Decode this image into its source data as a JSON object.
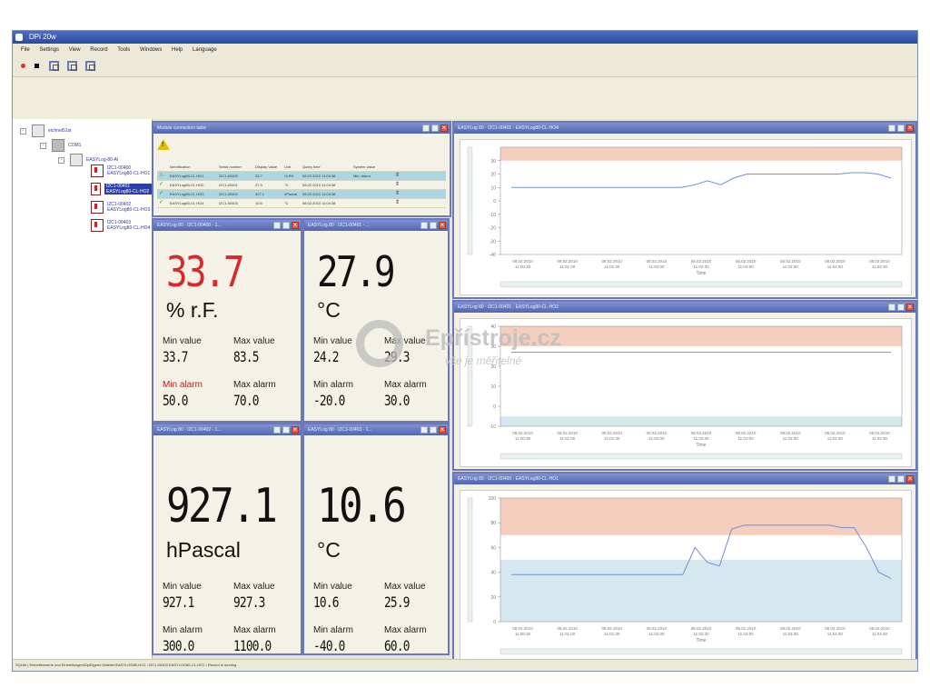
{
  "app": {
    "title": "DPi 20w"
  },
  "menu": [
    "File",
    "Settings",
    "View",
    "Record",
    "Tools",
    "Windows",
    "Help",
    "Language"
  ],
  "toolbar": {
    "icons": [
      "record-icon",
      "stop-icon",
      "window-icon",
      "window-icon",
      "window-icon"
    ]
  },
  "tree": {
    "items": [
      {
        "label": "eichnet51st",
        "depth": 0
      },
      {
        "label": "COM1",
        "depth": 1
      },
      {
        "label": "EASYLog-80-Al",
        "depth": 2
      },
      {
        "label": "I2C1-00400 EASYLog80-CL-HO1",
        "depth": 3
      },
      {
        "label": "I2C1-00401 EASYLog80-CL-HO2",
        "depth": 3,
        "selected": true
      },
      {
        "label": "I2C1-00402 EASYLog80-CL-HO3",
        "depth": 3
      },
      {
        "label": "I2C1-00403 EASYLog80-CL-HO4",
        "depth": 3
      }
    ]
  },
  "table_window": {
    "title": "Module connection table",
    "headers": [
      "",
      "Identification",
      "Serial number",
      "Display Value",
      "Unit",
      "Query time",
      "System value",
      ""
    ],
    "rows": [
      {
        "cells": [
          "",
          "EASYLog80-CL HO1",
          "I2C1-00400",
          "33.7",
          "% RH",
          "08.02.2010 11:04:38",
          "Min. Alarm",
          ""
        ],
        "status": "warn",
        "highlight": true
      },
      {
        "cells": [
          "",
          "EASYLog80-CL HO2",
          "I2C1-00401",
          "27.9",
          "°C",
          "08.02.2010 11:04:38",
          "",
          ""
        ],
        "status": "ok",
        "highlight": false
      },
      {
        "cells": [
          "",
          "EASYLog80-CL HO3",
          "I2C1-00402",
          "927.1",
          "hPascal",
          "08.02.2010 11:04:38",
          "",
          ""
        ],
        "status": "ok",
        "highlight": true
      },
      {
        "cells": [
          "",
          "EASYLog80-CL HO4",
          "I2C1-00403",
          "10.6",
          "°C",
          "08.02.2010 11:04:38",
          "",
          ""
        ],
        "status": "ok",
        "highlight": false
      }
    ]
  },
  "displays": [
    {
      "title": "EASYLog 80 · I2C1-00400 - 1...",
      "value": "33.7",
      "value_color": "#d8282a",
      "unit": "% r.F.",
      "min_value_label": "Min value",
      "min_value": "33.7",
      "max_value_label": "Max value",
      "max_value": "83.5",
      "min_alarm_label": "Min alarm",
      "min_alarm": "50.0",
      "min_alarm_red": true,
      "max_alarm_label": "Max alarm",
      "max_alarm": "70.0"
    },
    {
      "title": "EASYLog 80 · I2C1-00401 - ...",
      "value": "27.9",
      "value_color": "#111111",
      "unit": "°C",
      "min_value_label": "Min value",
      "min_value": "24.2",
      "max_value_label": "Max value",
      "max_value": "29.3",
      "min_alarm_label": "Min alarm",
      "min_alarm": "-20.0",
      "min_alarm_red": false,
      "max_alarm_label": "Max alarm",
      "max_alarm": "30.0"
    },
    {
      "title": "EASYLog 80 · I2C1-00402 - 1...",
      "value": "927.1",
      "value_color": "#111111",
      "unit": "hPascal",
      "min_value_label": "Min value",
      "min_value": "927.1",
      "max_value_label": "Max value",
      "max_value": "927.3",
      "min_alarm_label": "Min alarm",
      "min_alarm": "300.0",
      "min_alarm_red": false,
      "max_alarm_label": "Max alarm",
      "max_alarm": "1100.0"
    },
    {
      "title": "EASYLog 80 · I2C1-00403 - 1...",
      "value": "10.6",
      "value_color": "#111111",
      "unit": "°C",
      "min_value_label": "Min value",
      "min_value": "10.6",
      "max_value_label": "Max value",
      "max_value": "25.9",
      "min_alarm_label": "Min alarm",
      "min_alarm": "-40.0",
      "min_alarm_red": false,
      "max_alarm_label": "Max alarm",
      "max_alarm": "60.0"
    }
  ],
  "chart_windows": [
    {
      "title": "EASYLog 80 · I2C1-00401 · EASYLog80-CL-HO4"
    },
    {
      "title": "EASYLog 80 · I2C1-00401 · EASYLog80-CL-HO2"
    },
    {
      "title": "EASYLog 80 · I2C1-00400 · EASYLog80-CL-HO1"
    }
  ],
  "chart_data": [
    {
      "type": "line",
      "ylim": [
        -40,
        40
      ],
      "yticks": [
        -40,
        -30,
        -20,
        -10,
        0,
        10,
        20,
        30
      ],
      "xlabel": "Time",
      "xticks": [
        "08.02.2010 11:00:30",
        "08.02.2010 11:01:00",
        "08.02.2010 11:01:30",
        "08.02.2010 11:02:00",
        "08.02.2010 11:02:30",
        "08.02.2010 11:03:00",
        "08.02.2010 11:03:30",
        "08.02.2010 11:04:00",
        "08.02.2010 11:04:30"
      ],
      "alarm_high": 30,
      "alarm_low": -40,
      "series": [
        {
          "values": [
            10,
            10,
            10,
            10,
            10,
            10,
            10,
            10,
            10,
            10,
            10,
            10,
            10,
            10,
            12,
            15,
            12,
            17,
            20,
            20,
            20,
            20,
            20,
            20,
            20,
            20,
            21,
            21,
            20,
            17
          ]
        }
      ]
    },
    {
      "type": "line",
      "ylim": [
        -10,
        40
      ],
      "yticks": [
        -10,
        0,
        10,
        20,
        30,
        40
      ],
      "xlabel": "Time",
      "xticks": [
        "08.02.2010 11:00:30",
        "08.02.2010 11:01:00",
        "08.02.2010 11:01:30",
        "08.02.2010 11:02:00",
        "08.02.2010 11:02:30",
        "08.02.2010 11:03:00",
        "08.02.2010 11:03:30",
        "08.02.2010 11:04:00",
        "08.02.2010 11:04:30"
      ],
      "alarm_high": 30,
      "alarm_low": -5,
      "series": [
        {
          "values": [
            27,
            27,
            27,
            27,
            27,
            27,
            27,
            27,
            27,
            27,
            27,
            27,
            27,
            27,
            27,
            27,
            27,
            27,
            27,
            27,
            27,
            27,
            27,
            27,
            27,
            27,
            27,
            27,
            27,
            27
          ]
        }
      ]
    },
    {
      "type": "line",
      "ylim": [
        0,
        100
      ],
      "yticks": [
        0,
        20,
        40,
        60,
        80,
        100
      ],
      "xlabel": "Time",
      "xticks": [
        "08.02.2010 11:00:30",
        "08.02.2010 11:01:00",
        "08.02.2010 11:01:30",
        "08.02.2010 11:02:00",
        "08.02.2010 11:02:30",
        "08.02.2010 11:03:00",
        "08.02.2010 11:03:30",
        "08.02.2010 11:04:00",
        "08.02.2010 11:04:30"
      ],
      "alarm_high": 70,
      "alarm_low": 50,
      "series": [
        {
          "values": [
            38,
            38,
            38,
            38,
            38,
            38,
            38,
            38,
            38,
            38,
            38,
            38,
            38,
            38,
            38,
            60,
            48,
            45,
            75,
            78,
            78,
            78,
            78,
            78,
            78,
            78,
            78,
            76,
            76,
            60,
            40,
            35
          ]
        }
      ]
    }
  ],
  "statusbar": {
    "text": "SQLite | Einheitenwerte und Einstellungen\\DpiEigene Dateien\\EASYLOG80-HO1 \\ I2C1-00400 EASYLOG80-CL-HO1 \\ Record is running"
  },
  "watermark": {
    "title": "Epřístroje.cz",
    "subtitle": "vše je měřitelné"
  },
  "colors": {
    "alarm_high": "#f5cfbe",
    "alarm_low": "#d5e8f0",
    "series": "#6f8fd6",
    "alarm_red": "#d8282a"
  }
}
